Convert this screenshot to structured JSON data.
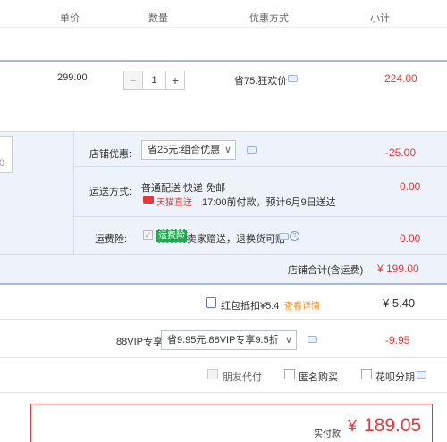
{
  "header": {
    "col_price": "单价",
    "col_qty": "数量",
    "col_promo": "优惠方式",
    "col_subtotal": "小计"
  },
  "item": {
    "price": "299.00",
    "qty": "1",
    "minus": "−",
    "plus": "+",
    "promo": "省75:狂欢价",
    "subtotal": "224.00"
  },
  "shop": {
    "discount_label": "店铺优惠:",
    "discount_value": "省25元:组合优惠",
    "discount_amount": "-25.00",
    "shipping_label": "运送方式:",
    "shipping_method": "普通配送 快递 免邮",
    "tmall_badge": "天猫直送",
    "shipping_eta": "17:00前付款，预计6月9日送达",
    "shipping_amount": "0.00",
    "insurance_label": "运费险:",
    "insurance_tag": "运费险",
    "insurance_text": "卖家赠送，退换货可赔",
    "insurance_amount": "0.00",
    "total_label": "店铺合计(含运费)",
    "total_value": "¥ 199.00",
    "left_partial_text": "0"
  },
  "redpack": {
    "label": "红包抵扣¥5.4",
    "detail_link": "查看详情",
    "amount": "¥ 5.40"
  },
  "vip": {
    "label": "88VIP专享",
    "select": "省9.95元:88VIP专享9.5折",
    "amount": "-9.95"
  },
  "options": {
    "friend_pay": "朋友代付",
    "anonymous": "匿名购买",
    "huabei": "花呗分期"
  },
  "pay": {
    "label": "实付款:",
    "currency": "¥",
    "amount": "189.05"
  },
  "colors": {
    "accent_red": "#e4393c",
    "shop_bg": "#eef3fb",
    "border_blue": "#aab7d6"
  }
}
